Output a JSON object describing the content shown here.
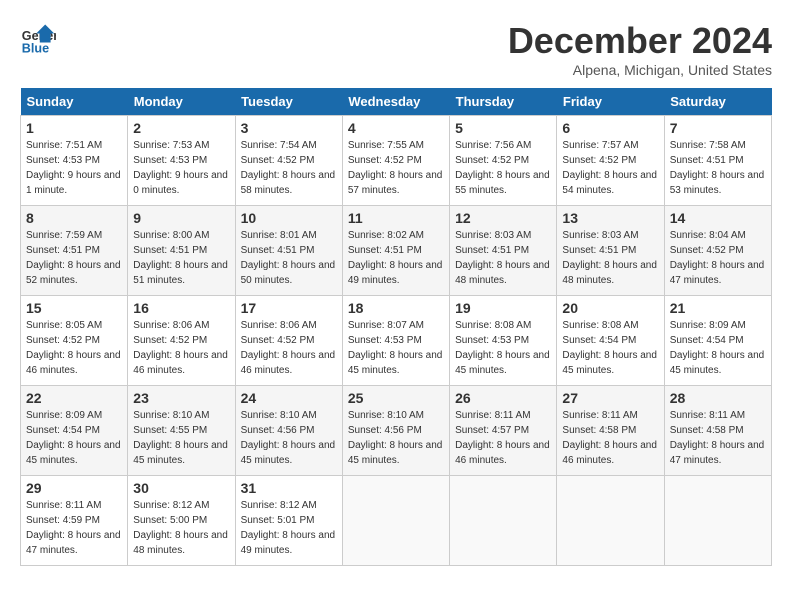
{
  "logo": {
    "text_general": "General",
    "text_blue": "Blue"
  },
  "header": {
    "month": "December 2024",
    "location": "Alpena, Michigan, United States"
  },
  "days_of_week": [
    "Sunday",
    "Monday",
    "Tuesday",
    "Wednesday",
    "Thursday",
    "Friday",
    "Saturday"
  ],
  "weeks": [
    [
      {
        "day": "1",
        "sunrise": "Sunrise: 7:51 AM",
        "sunset": "Sunset: 4:53 PM",
        "daylight": "Daylight: 9 hours and 1 minute."
      },
      {
        "day": "2",
        "sunrise": "Sunrise: 7:53 AM",
        "sunset": "Sunset: 4:53 PM",
        "daylight": "Daylight: 9 hours and 0 minutes."
      },
      {
        "day": "3",
        "sunrise": "Sunrise: 7:54 AM",
        "sunset": "Sunset: 4:52 PM",
        "daylight": "Daylight: 8 hours and 58 minutes."
      },
      {
        "day": "4",
        "sunrise": "Sunrise: 7:55 AM",
        "sunset": "Sunset: 4:52 PM",
        "daylight": "Daylight: 8 hours and 57 minutes."
      },
      {
        "day": "5",
        "sunrise": "Sunrise: 7:56 AM",
        "sunset": "Sunset: 4:52 PM",
        "daylight": "Daylight: 8 hours and 55 minutes."
      },
      {
        "day": "6",
        "sunrise": "Sunrise: 7:57 AM",
        "sunset": "Sunset: 4:52 PM",
        "daylight": "Daylight: 8 hours and 54 minutes."
      },
      {
        "day": "7",
        "sunrise": "Sunrise: 7:58 AM",
        "sunset": "Sunset: 4:51 PM",
        "daylight": "Daylight: 8 hours and 53 minutes."
      }
    ],
    [
      {
        "day": "8",
        "sunrise": "Sunrise: 7:59 AM",
        "sunset": "Sunset: 4:51 PM",
        "daylight": "Daylight: 8 hours and 52 minutes."
      },
      {
        "day": "9",
        "sunrise": "Sunrise: 8:00 AM",
        "sunset": "Sunset: 4:51 PM",
        "daylight": "Daylight: 8 hours and 51 minutes."
      },
      {
        "day": "10",
        "sunrise": "Sunrise: 8:01 AM",
        "sunset": "Sunset: 4:51 PM",
        "daylight": "Daylight: 8 hours and 50 minutes."
      },
      {
        "day": "11",
        "sunrise": "Sunrise: 8:02 AM",
        "sunset": "Sunset: 4:51 PM",
        "daylight": "Daylight: 8 hours and 49 minutes."
      },
      {
        "day": "12",
        "sunrise": "Sunrise: 8:03 AM",
        "sunset": "Sunset: 4:51 PM",
        "daylight": "Daylight: 8 hours and 48 minutes."
      },
      {
        "day": "13",
        "sunrise": "Sunrise: 8:03 AM",
        "sunset": "Sunset: 4:51 PM",
        "daylight": "Daylight: 8 hours and 48 minutes."
      },
      {
        "day": "14",
        "sunrise": "Sunrise: 8:04 AM",
        "sunset": "Sunset: 4:52 PM",
        "daylight": "Daylight: 8 hours and 47 minutes."
      }
    ],
    [
      {
        "day": "15",
        "sunrise": "Sunrise: 8:05 AM",
        "sunset": "Sunset: 4:52 PM",
        "daylight": "Daylight: 8 hours and 46 minutes."
      },
      {
        "day": "16",
        "sunrise": "Sunrise: 8:06 AM",
        "sunset": "Sunset: 4:52 PM",
        "daylight": "Daylight: 8 hours and 46 minutes."
      },
      {
        "day": "17",
        "sunrise": "Sunrise: 8:06 AM",
        "sunset": "Sunset: 4:52 PM",
        "daylight": "Daylight: 8 hours and 46 minutes."
      },
      {
        "day": "18",
        "sunrise": "Sunrise: 8:07 AM",
        "sunset": "Sunset: 4:53 PM",
        "daylight": "Daylight: 8 hours and 45 minutes."
      },
      {
        "day": "19",
        "sunrise": "Sunrise: 8:08 AM",
        "sunset": "Sunset: 4:53 PM",
        "daylight": "Daylight: 8 hours and 45 minutes."
      },
      {
        "day": "20",
        "sunrise": "Sunrise: 8:08 AM",
        "sunset": "Sunset: 4:54 PM",
        "daylight": "Daylight: 8 hours and 45 minutes."
      },
      {
        "day": "21",
        "sunrise": "Sunrise: 8:09 AM",
        "sunset": "Sunset: 4:54 PM",
        "daylight": "Daylight: 8 hours and 45 minutes."
      }
    ],
    [
      {
        "day": "22",
        "sunrise": "Sunrise: 8:09 AM",
        "sunset": "Sunset: 4:54 PM",
        "daylight": "Daylight: 8 hours and 45 minutes."
      },
      {
        "day": "23",
        "sunrise": "Sunrise: 8:10 AM",
        "sunset": "Sunset: 4:55 PM",
        "daylight": "Daylight: 8 hours and 45 minutes."
      },
      {
        "day": "24",
        "sunrise": "Sunrise: 8:10 AM",
        "sunset": "Sunset: 4:56 PM",
        "daylight": "Daylight: 8 hours and 45 minutes."
      },
      {
        "day": "25",
        "sunrise": "Sunrise: 8:10 AM",
        "sunset": "Sunset: 4:56 PM",
        "daylight": "Daylight: 8 hours and 45 minutes."
      },
      {
        "day": "26",
        "sunrise": "Sunrise: 8:11 AM",
        "sunset": "Sunset: 4:57 PM",
        "daylight": "Daylight: 8 hours and 46 minutes."
      },
      {
        "day": "27",
        "sunrise": "Sunrise: 8:11 AM",
        "sunset": "Sunset: 4:58 PM",
        "daylight": "Daylight: 8 hours and 46 minutes."
      },
      {
        "day": "28",
        "sunrise": "Sunrise: 8:11 AM",
        "sunset": "Sunset: 4:58 PM",
        "daylight": "Daylight: 8 hours and 47 minutes."
      }
    ],
    [
      {
        "day": "29",
        "sunrise": "Sunrise: 8:11 AM",
        "sunset": "Sunset: 4:59 PM",
        "daylight": "Daylight: 8 hours and 47 minutes."
      },
      {
        "day": "30",
        "sunrise": "Sunrise: 8:12 AM",
        "sunset": "Sunset: 5:00 PM",
        "daylight": "Daylight: 8 hours and 48 minutes."
      },
      {
        "day": "31",
        "sunrise": "Sunrise: 8:12 AM",
        "sunset": "Sunset: 5:01 PM",
        "daylight": "Daylight: 8 hours and 49 minutes."
      },
      null,
      null,
      null,
      null
    ]
  ]
}
